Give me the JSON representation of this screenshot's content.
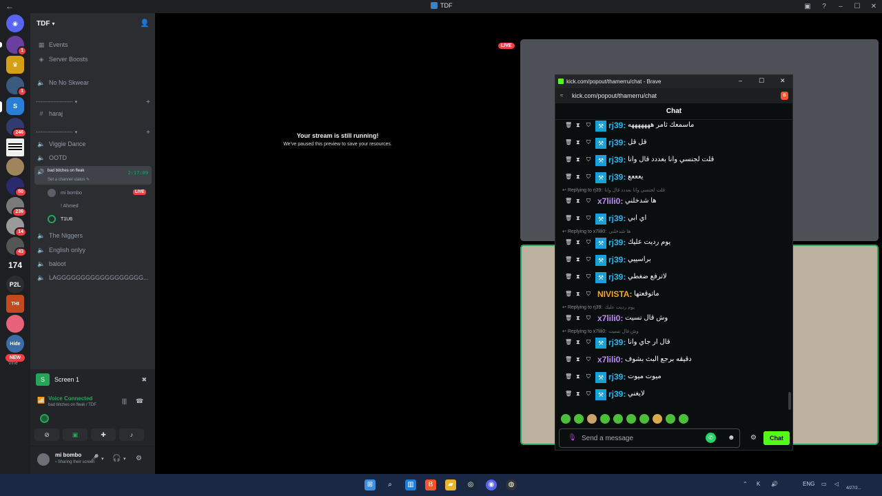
{
  "window": {
    "title": "TDF"
  },
  "server": {
    "name": "TDF"
  },
  "rail": {
    "badges": [
      "1",
      "1",
      "246",
      "50",
      "236",
      "14",
      "43"
    ],
    "labels": [
      "174",
      "P2L",
      "THI",
      "Hide",
      "NEW",
      "Vine"
    ]
  },
  "sidebar": {
    "top_items": [
      "Events",
      "Server Boosts"
    ],
    "channels": {
      "no_no_skwear": "No No Skwear",
      "haraj": "haraj",
      "viggie_dance": "Viggie Dance",
      "ootd": "OOTD",
      "the_niggers": "The Niggers",
      "english_onlyy": "English onlyy",
      "baloot": "baloot",
      "lag": "LAGGGGGGGGGGGGGGGGGG..."
    },
    "category_sep": "-----------------------",
    "active_channel": {
      "name": "bad bitches on fleak",
      "status": "Set a channel status",
      "timer": "2:17:09"
    },
    "voice_users": [
      {
        "name": "mi bombo",
        "live": "LIVE"
      },
      {
        "name": "! Ahmed"
      },
      {
        "name": "T1U6"
      }
    ]
  },
  "screen_panel": {
    "label": "Screen 1"
  },
  "voice_panel": {
    "status": "Voice Connected",
    "sub": "bad bitches on fleak / TDF"
  },
  "user_panel": {
    "name": "mi bombo",
    "status": "Sharing their screen"
  },
  "stage": {
    "live_badge": "LIVE",
    "paused_title": "Your stream is still running!",
    "paused_sub": "We've paused this preview to save your resources."
  },
  "popout": {
    "window_title": "kick.com/popout/thamerru/chat - Brave",
    "url": "kick.com/popout/thamerru/chat",
    "chat_header": "Chat",
    "input_placeholder": "Send a message",
    "send_label": "Chat",
    "messages": [
      {
        "type": "msg",
        "user": "rj39:",
        "text": "ماسمعك ثامر هههههههه",
        "color": "#22b8f0",
        "badge": true
      },
      {
        "type": "msg",
        "user": "rj39:",
        "text": "قل قل",
        "color": "#22b8f0",
        "badge": true
      },
      {
        "type": "msg",
        "user": "rj39:",
        "text": "قلت لجنسي وانا بعددد قال وانا",
        "color": "#22b8f0",
        "badge": true
      },
      {
        "type": "msg",
        "user": "rj39:",
        "text": "يعععع",
        "color": "#22b8f0",
        "badge": true
      },
      {
        "type": "reply",
        "text": "Replying to rj39:",
        "quote": "قلت لجنسي وانا بعددد قال وانا"
      },
      {
        "type": "msg",
        "user": "x7lili0:",
        "text": "ها شدخلني",
        "color": "#c08cf5",
        "badge": false
      },
      {
        "type": "msg",
        "user": "rj39:",
        "text": "اي ابي",
        "color": "#22b8f0",
        "badge": true
      },
      {
        "type": "reply",
        "text": "Replying to x7lili0:",
        "quote": "ها شدخلني"
      },
      {
        "type": "msg",
        "user": "rj39:",
        "text": "يوم رديت عليك",
        "color": "#22b8f0",
        "badge": true
      },
      {
        "type": "msg",
        "user": "rj39:",
        "text": "براسييي",
        "color": "#22b8f0",
        "badge": true
      },
      {
        "type": "msg",
        "user": "rj39:",
        "text": "لاترفع ضغطي",
        "color": "#22b8f0",
        "badge": true
      },
      {
        "type": "msg",
        "user": "NIVISTA:",
        "text": "ماتوقعتها",
        "color": "#f5a623",
        "badge": false
      },
      {
        "type": "reply",
        "text": "Replying to rj39:",
        "quote": "يوم رديت عليك"
      },
      {
        "type": "msg",
        "user": "x7lili0:",
        "text": "وش قال نسيت",
        "color": "#c08cf5",
        "badge": false
      },
      {
        "type": "reply",
        "text": "Replying to x7lili0:",
        "quote": "وش قال نسيت"
      },
      {
        "type": "msg",
        "user": "rj39:",
        "text": "قال ار جاي وانا",
        "color": "#22b8f0",
        "badge": true
      },
      {
        "type": "msg",
        "user": "x7lili0:",
        "text": "دقيقه برجع البث بشوف",
        "color": "#c08cf5",
        "badge": false
      },
      {
        "type": "msg",
        "user": "rj39:",
        "text": "ميوت ميوت",
        "color": "#22b8f0",
        "badge": true
      },
      {
        "type": "msg",
        "user": "rj39:",
        "text": "لايغني",
        "color": "#22b8f0",
        "badge": true
      }
    ]
  },
  "taskbar": {
    "lang": "ENG",
    "date": "4/27/2..."
  },
  "colors": {
    "discord_green": "#23a55a",
    "kick_green": "#53fc18",
    "live_red": "#f23f43"
  }
}
